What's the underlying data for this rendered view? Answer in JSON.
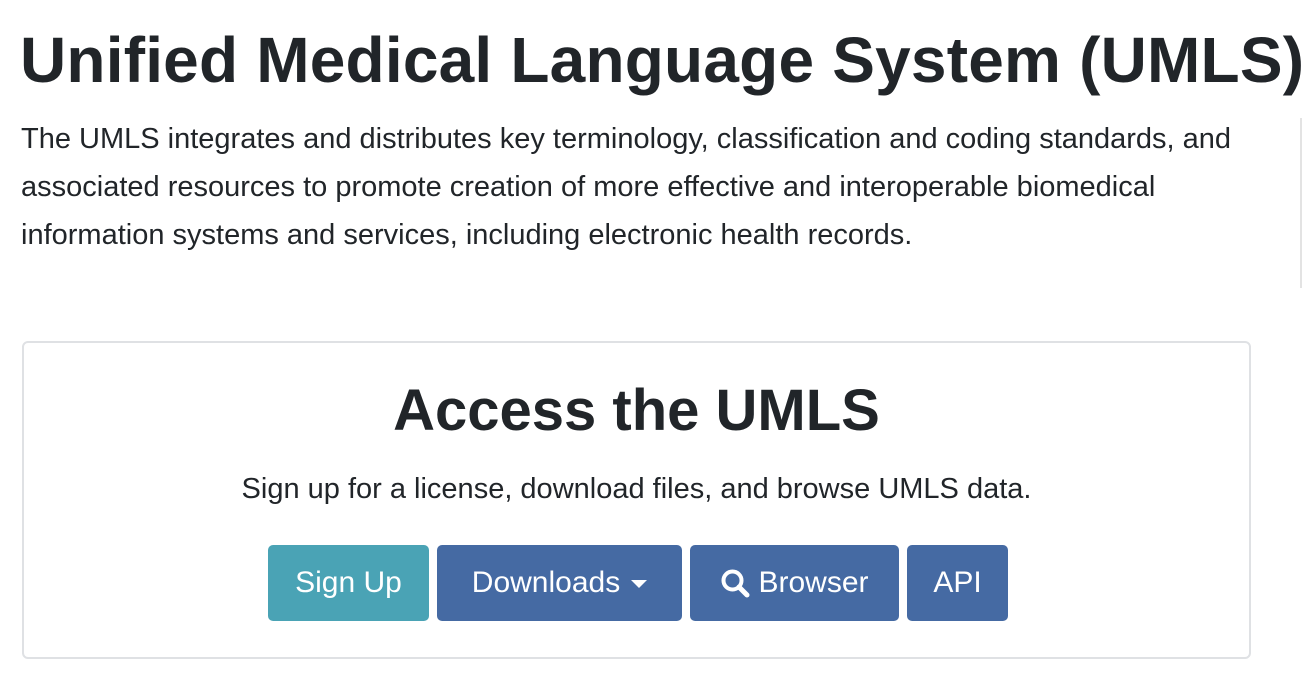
{
  "page": {
    "title": "Unified Medical Language System (UMLS)",
    "intro": "The UMLS integrates and distributes key terminology, classification and coding standards, and associated resources to promote creation of more effective and interoperable biomedical information systems and services, including electronic health records."
  },
  "access_card": {
    "title": "Access the UMLS",
    "subtitle": "Sign up for a license, download files, and browse UMLS data.",
    "buttons": {
      "signup_label": "Sign Up",
      "downloads_label": "Downloads",
      "browser_label": "Browser",
      "api_label": "API"
    },
    "icons": {
      "browser_icon": "search-icon",
      "downloads_icon": "caret-down-icon"
    }
  },
  "colors": {
    "text": "#212529",
    "signup_button": "#4aa3b5",
    "primary_button": "#456aa3",
    "card_border": "#dfe1e4"
  }
}
